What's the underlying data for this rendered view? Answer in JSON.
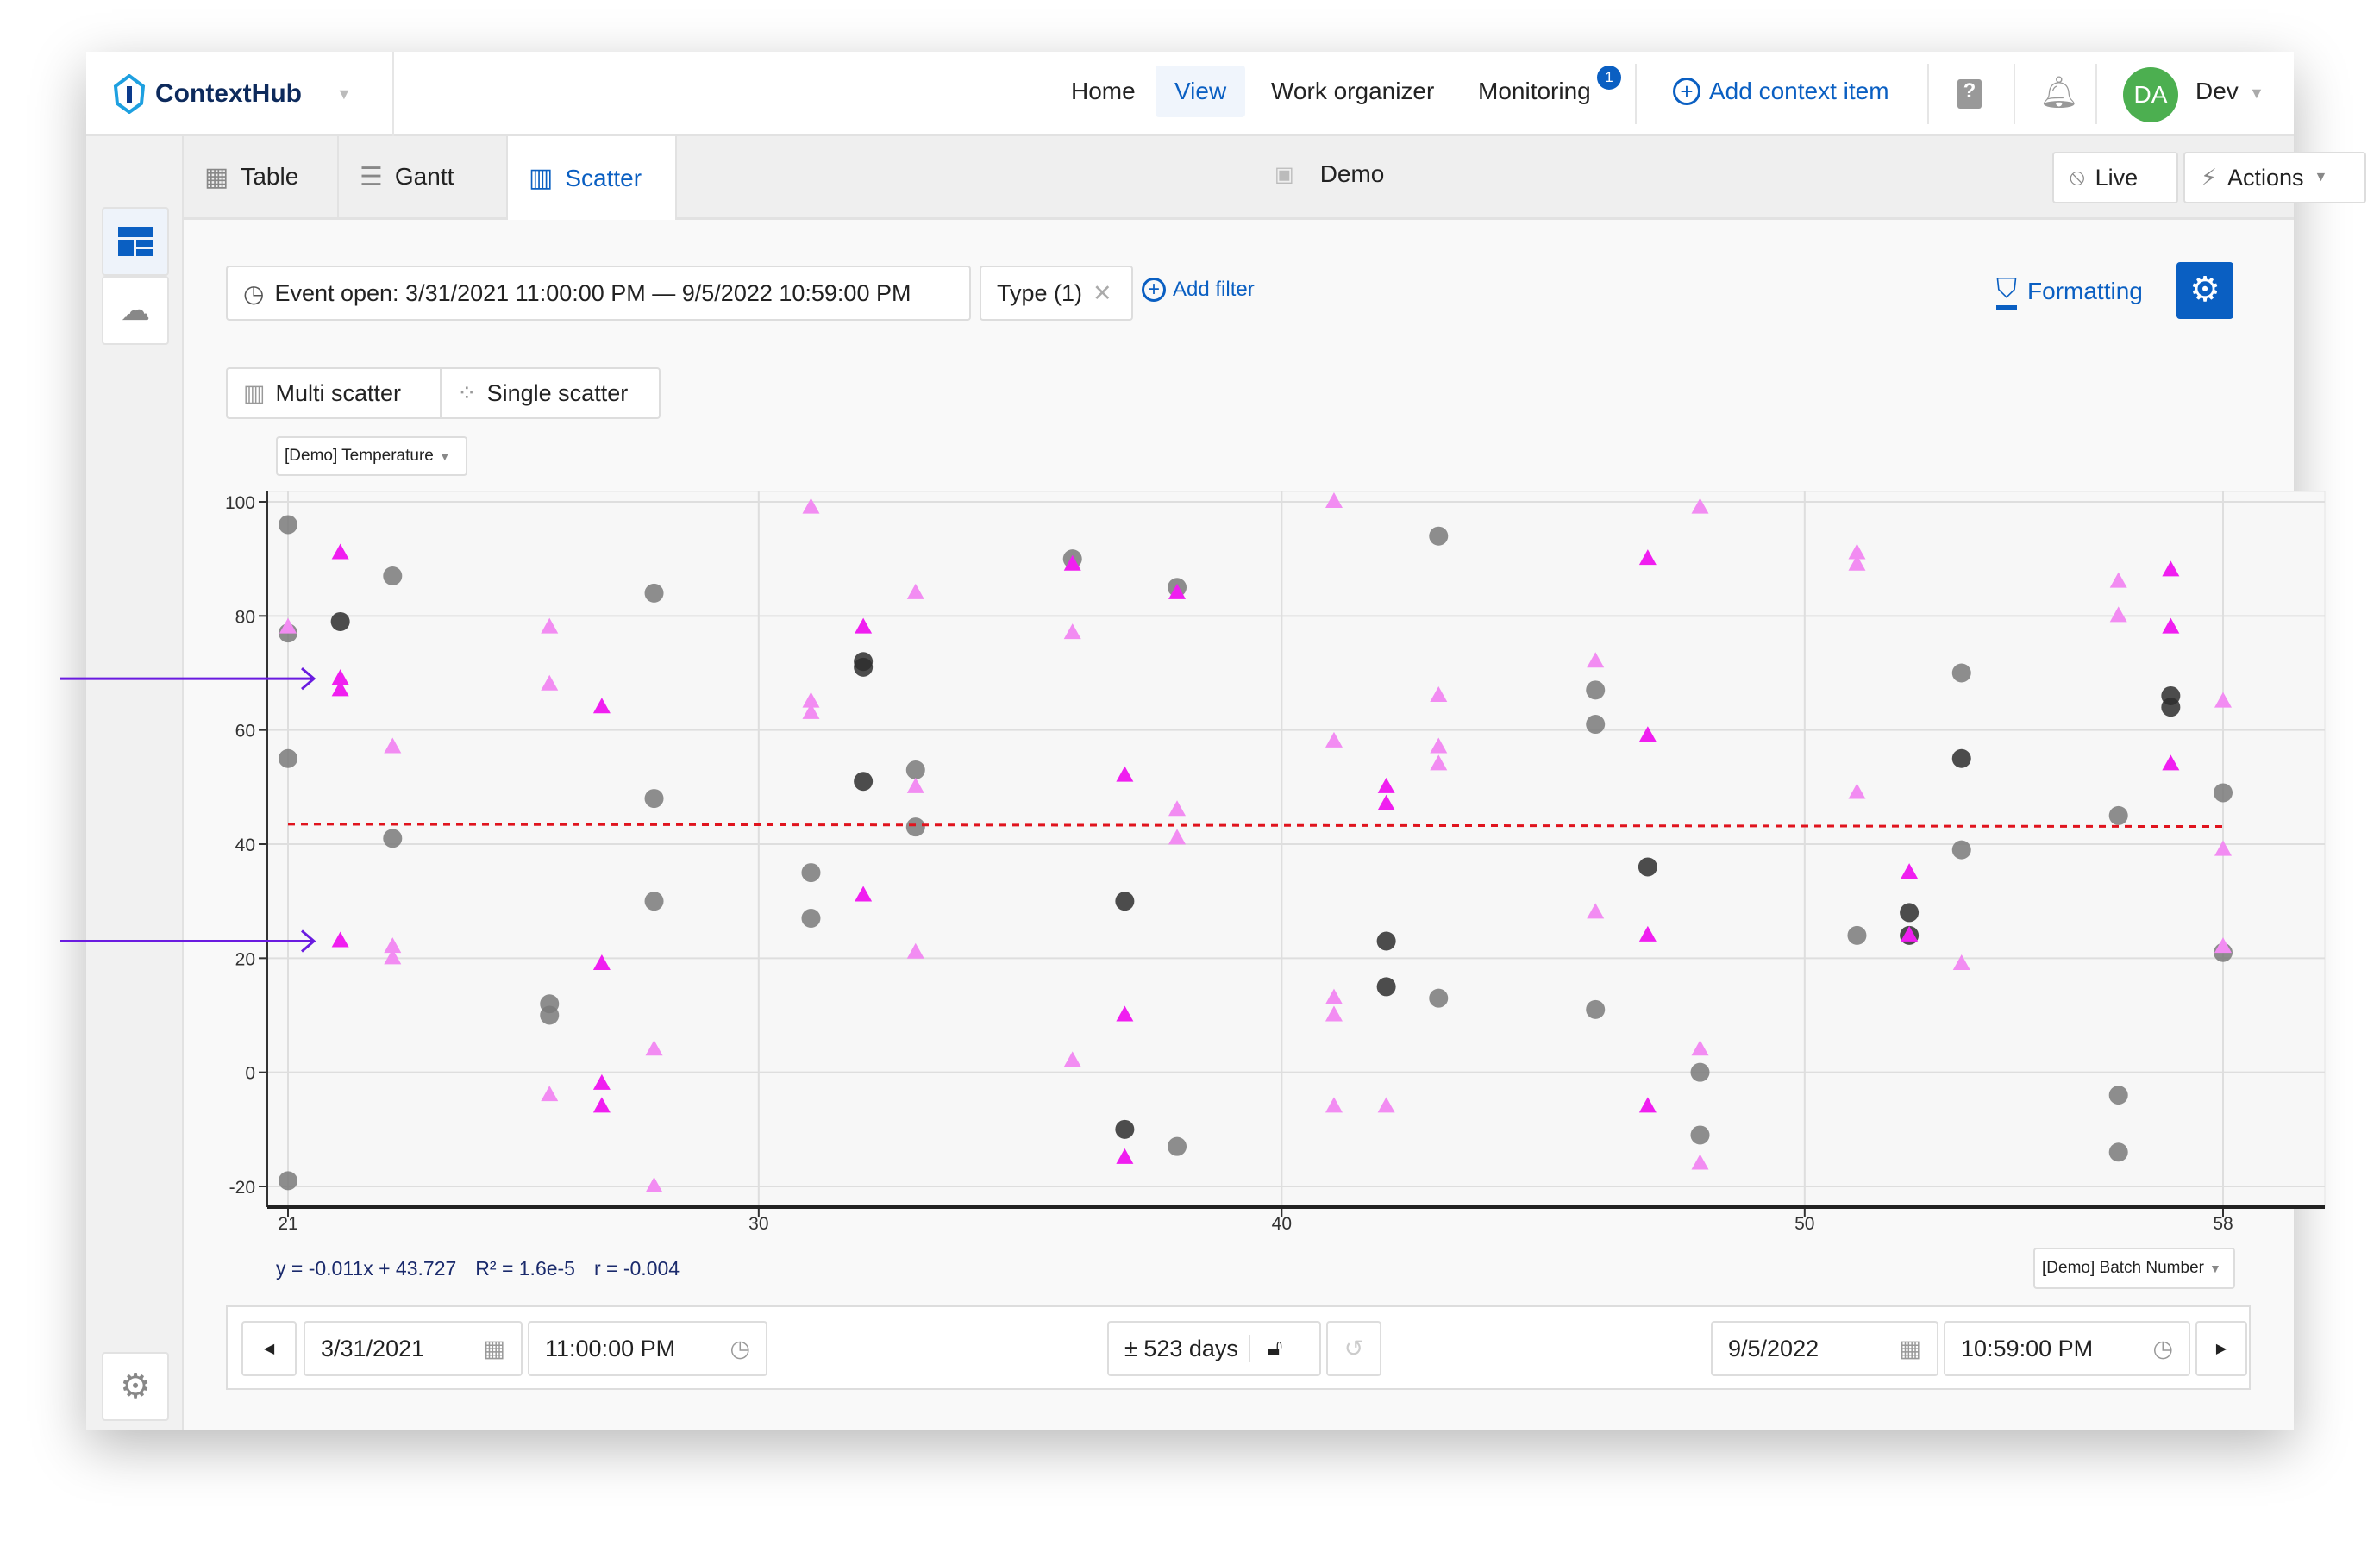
{
  "nav": {
    "brand": "ContextHub",
    "items": [
      "Home",
      "View",
      "Work organizer",
      "Monitoring"
    ],
    "active": "View",
    "monitoring_badge": "1",
    "add_context": "Add context item",
    "avatar": "DA",
    "user": "Dev"
  },
  "tabs": {
    "items": [
      "Table",
      "Gantt",
      "Scatter"
    ],
    "active": "Scatter",
    "view_name": "Demo",
    "live": "Live",
    "actions": "Actions"
  },
  "filters": {
    "event": "Event open: 3/31/2021 11:00:00 PM — 9/5/2022 10:59:00 PM",
    "type": "Type (1)",
    "add_filter": "Add filter",
    "formatting": "Formatting"
  },
  "modes": {
    "multi": "Multi scatter",
    "single": "Single scatter"
  },
  "y_selector": "[Demo] Temperature",
  "x_selector": "[Demo] Batch Number",
  "regression": {
    "eq": "y = -0.011x + 43.727",
    "r2": "R² = 1.6e-5",
    "r": "r = -0.004"
  },
  "range": {
    "start_date": "3/31/2021",
    "start_time": "11:00:00 PM",
    "span": "± 523 days",
    "end_date": "9/5/2022",
    "end_time": "10:59:00 PM"
  },
  "colors": {
    "accent": "#0a5fc2",
    "avatar": "#4caf50",
    "regression": "#e0141e",
    "annotation_arrow": "#6a1be0"
  },
  "chart_data": {
    "type": "scatter",
    "xlim": [
      21,
      58
    ],
    "ylim": [
      -20,
      100
    ],
    "x_ticks": [
      21,
      30,
      40,
      50,
      58
    ],
    "y_ticks": [
      -20,
      0,
      20,
      40,
      60,
      80,
      100
    ],
    "grid": true,
    "regression": {
      "slope": -0.011,
      "intercept": 43.727
    },
    "annotation_arrows_y": [
      69,
      23
    ],
    "series": [
      {
        "marker": "circle",
        "color": "#7a7a7a",
        "points": [
          [
            21,
            96
          ],
          [
            21,
            77
          ],
          [
            21,
            55
          ],
          [
            21,
            -19
          ],
          [
            23,
            87
          ],
          [
            23,
            41
          ],
          [
            26,
            12
          ],
          [
            26,
            10
          ],
          [
            28,
            84
          ],
          [
            28,
            48
          ],
          [
            28,
            30
          ],
          [
            31,
            35
          ],
          [
            31,
            27
          ],
          [
            33,
            53
          ],
          [
            33,
            43
          ],
          [
            36,
            90
          ],
          [
            38,
            85
          ],
          [
            38,
            -13
          ],
          [
            43,
            94
          ],
          [
            43,
            13
          ],
          [
            46,
            67
          ],
          [
            46,
            61
          ],
          [
            46,
            11
          ],
          [
            48,
            0
          ],
          [
            48,
            -11
          ],
          [
            51,
            24
          ],
          [
            53,
            70
          ],
          [
            53,
            39
          ],
          [
            56,
            45
          ],
          [
            56,
            -4
          ],
          [
            56,
            -14
          ],
          [
            58,
            49
          ],
          [
            58,
            21
          ]
        ]
      },
      {
        "marker": "circle",
        "color": "#2e2e2e",
        "points": [
          [
            22,
            79
          ],
          [
            32,
            72
          ],
          [
            32,
            71
          ],
          [
            32,
            51
          ],
          [
            37,
            30
          ],
          [
            37,
            -10
          ],
          [
            42,
            23
          ],
          [
            42,
            15
          ],
          [
            47,
            36
          ],
          [
            52,
            28
          ],
          [
            52,
            24
          ],
          [
            53,
            55
          ],
          [
            57,
            66
          ],
          [
            57,
            64
          ]
        ]
      },
      {
        "marker": "triangle",
        "color": "#f01ef0",
        "points": [
          [
            22,
            91
          ],
          [
            22,
            69
          ],
          [
            22,
            67
          ],
          [
            22,
            23
          ],
          [
            27,
            64
          ],
          [
            27,
            19
          ],
          [
            27,
            -2
          ],
          [
            27,
            -6
          ],
          [
            32,
            78
          ],
          [
            32,
            31
          ],
          [
            36,
            89
          ],
          [
            37,
            52
          ],
          [
            37,
            10
          ],
          [
            37,
            -15
          ],
          [
            38,
            84
          ],
          [
            42,
            50
          ],
          [
            42,
            47
          ],
          [
            47,
            90
          ],
          [
            47,
            59
          ],
          [
            47,
            24
          ],
          [
            47,
            -6
          ],
          [
            52,
            35
          ],
          [
            52,
            24
          ],
          [
            57,
            88
          ],
          [
            57,
            78
          ],
          [
            57,
            54
          ]
        ]
      },
      {
        "marker": "triangle",
        "color": "#f28cf2",
        "points": [
          [
            21,
            78
          ],
          [
            23,
            57
          ],
          [
            23,
            22
          ],
          [
            23,
            20
          ],
          [
            26,
            78
          ],
          [
            26,
            68
          ],
          [
            26,
            -4
          ],
          [
            28,
            4
          ],
          [
            28,
            -20
          ],
          [
            31,
            99
          ],
          [
            31,
            65
          ],
          [
            31,
            63
          ],
          [
            33,
            84
          ],
          [
            33,
            50
          ],
          [
            33,
            21
          ],
          [
            36,
            77
          ],
          [
            36,
            2
          ],
          [
            38,
            46
          ],
          [
            38,
            41
          ],
          [
            41,
            100
          ],
          [
            41,
            58
          ],
          [
            41,
            13
          ],
          [
            41,
            10
          ],
          [
            41,
            -6
          ],
          [
            42,
            -6
          ],
          [
            43,
            66
          ],
          [
            43,
            57
          ],
          [
            43,
            54
          ],
          [
            46,
            72
          ],
          [
            46,
            28
          ],
          [
            48,
            99
          ],
          [
            48,
            4
          ],
          [
            48,
            -16
          ],
          [
            51,
            91
          ],
          [
            51,
            89
          ],
          [
            51,
            49
          ],
          [
            53,
            19
          ],
          [
            56,
            86
          ],
          [
            56,
            80
          ],
          [
            58,
            65
          ],
          [
            58,
            39
          ],
          [
            58,
            22
          ]
        ]
      }
    ]
  }
}
